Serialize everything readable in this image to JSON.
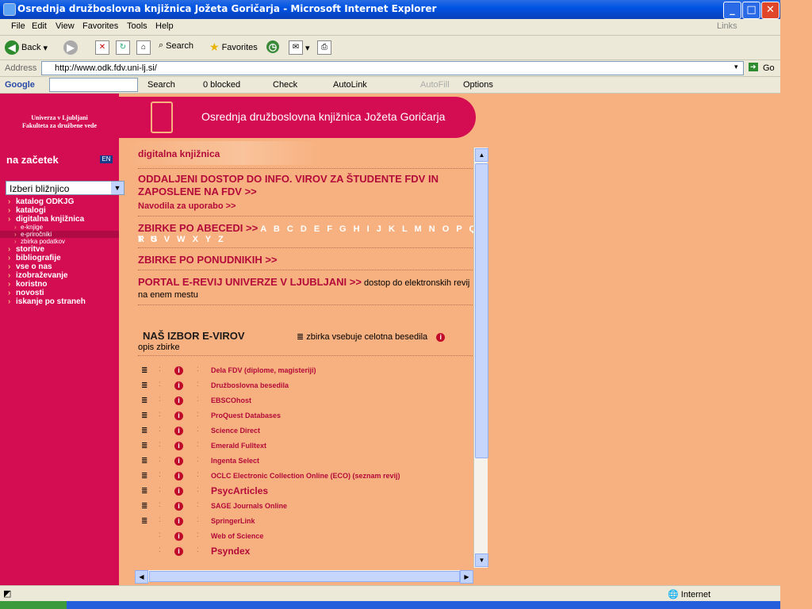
{
  "window": {
    "title": "Osrednja družboslovna knjižnica Jožeta Goričarja - Microsoft Internet Explorer"
  },
  "menu": [
    "File",
    "Edit",
    "View",
    "Favorites",
    "Tools",
    "Help"
  ],
  "links_label": "Links",
  "toolbar": {
    "back": "Back",
    "search": "Search",
    "favorites": "Favorites"
  },
  "address": {
    "label": "Address",
    "url": "http://www.odk.fdv.uni-lj.si/",
    "go": "Go"
  },
  "google_bar": {
    "brand": "Google",
    "search": "Search",
    "blocked": "0 blocked",
    "check": "Check",
    "autolink": "AutoLink",
    "autofill": "AutoFill",
    "options": "Options"
  },
  "site": {
    "uni_line1": "Univerza v Ljubljani",
    "uni_line2": "Fakulteta za družbene vede",
    "title": "Osrednja družboslovna knjižnica Jožeta Goričarja",
    "home": "na začetek",
    "flag": "EN",
    "shortcut_select": "Izberi bližnjico"
  },
  "nav": [
    {
      "label": "katalog ODKJG",
      "sub": false,
      "active": false
    },
    {
      "label": "katalogi",
      "sub": false,
      "active": false
    },
    {
      "label": "digitalna knjižnica",
      "sub": false,
      "active": false
    },
    {
      "label": "e-knjige",
      "sub": true,
      "active": false
    },
    {
      "label": "e-priročniki",
      "sub": true,
      "active": true
    },
    {
      "label": "zbirka podatkov",
      "sub": true,
      "active": false
    },
    {
      "label": "storitve",
      "sub": false,
      "active": false
    },
    {
      "label": "bibliografije",
      "sub": false,
      "active": false
    },
    {
      "label": "vse o nas",
      "sub": false,
      "active": false
    },
    {
      "label": "izobraževanje",
      "sub": false,
      "active": false
    },
    {
      "label": "koristno",
      "sub": false,
      "active": false
    },
    {
      "label": "novosti",
      "sub": false,
      "active": false
    },
    {
      "label": "iskanje po straneh",
      "sub": false,
      "active": false
    }
  ],
  "main": {
    "section_title": "digitalna knjižnica",
    "remote_access": "ODDALJENI DOSTOP DO INFO. VIROV ZA ŠTUDENTE FDV IN ZAPOSLENE NA FDV >>",
    "instructions": "Navodila za uporabo >>",
    "alpha_heading": "ZBIRKE PO ABECEDI >>",
    "alpha_letters_1": "A B C D E F G H I J K L M N O P Q R S",
    "alpha_letters_2": "T U V W X Y Z",
    "by_provider": "ZBIRKE PO PONUDNIKIH >>",
    "portal": "PORTAL E-REVIJ UNIVERZE V LJUBLJANI >>",
    "portal_desc": "dostop do elektronskih revij",
    "portal_desc2": "na enem mestu",
    "our_choice": "NAŠ IZBOR E-VIROV",
    "legend": "zbirka vsebuje celotna besedila",
    "collection_desc": "opis zbirke",
    "sources": [
      {
        "name": "Dela FDV  (diplome, magisteriji)",
        "fulltext": true,
        "big": false
      },
      {
        "name": "Družboslovna besedila",
        "fulltext": true,
        "big": false
      },
      {
        "name": "EBSCOhost",
        "fulltext": true,
        "big": false
      },
      {
        "name": "ProQuest Databases",
        "fulltext": true,
        "big": false
      },
      {
        "name": "Science Direct",
        "fulltext": true,
        "big": false
      },
      {
        "name": "Emerald Fulltext",
        "fulltext": true,
        "big": false
      },
      {
        "name": "Ingenta Select",
        "fulltext": true,
        "big": false
      },
      {
        "name": "OCLC Electronic Collection Online (ECO)  (seznam revij)",
        "fulltext": true,
        "big": false
      },
      {
        "name": "PsycArticles",
        "fulltext": true,
        "big": true
      },
      {
        "name": "SAGE Journals Online",
        "fulltext": true,
        "big": false
      },
      {
        "name": "SpringerLink",
        "fulltext": true,
        "big": false
      },
      {
        "name": "Web of Science",
        "fulltext": false,
        "big": false
      },
      {
        "name": "Psyndex",
        "fulltext": false,
        "big": true
      }
    ]
  },
  "status": {
    "zone": "Internet"
  }
}
